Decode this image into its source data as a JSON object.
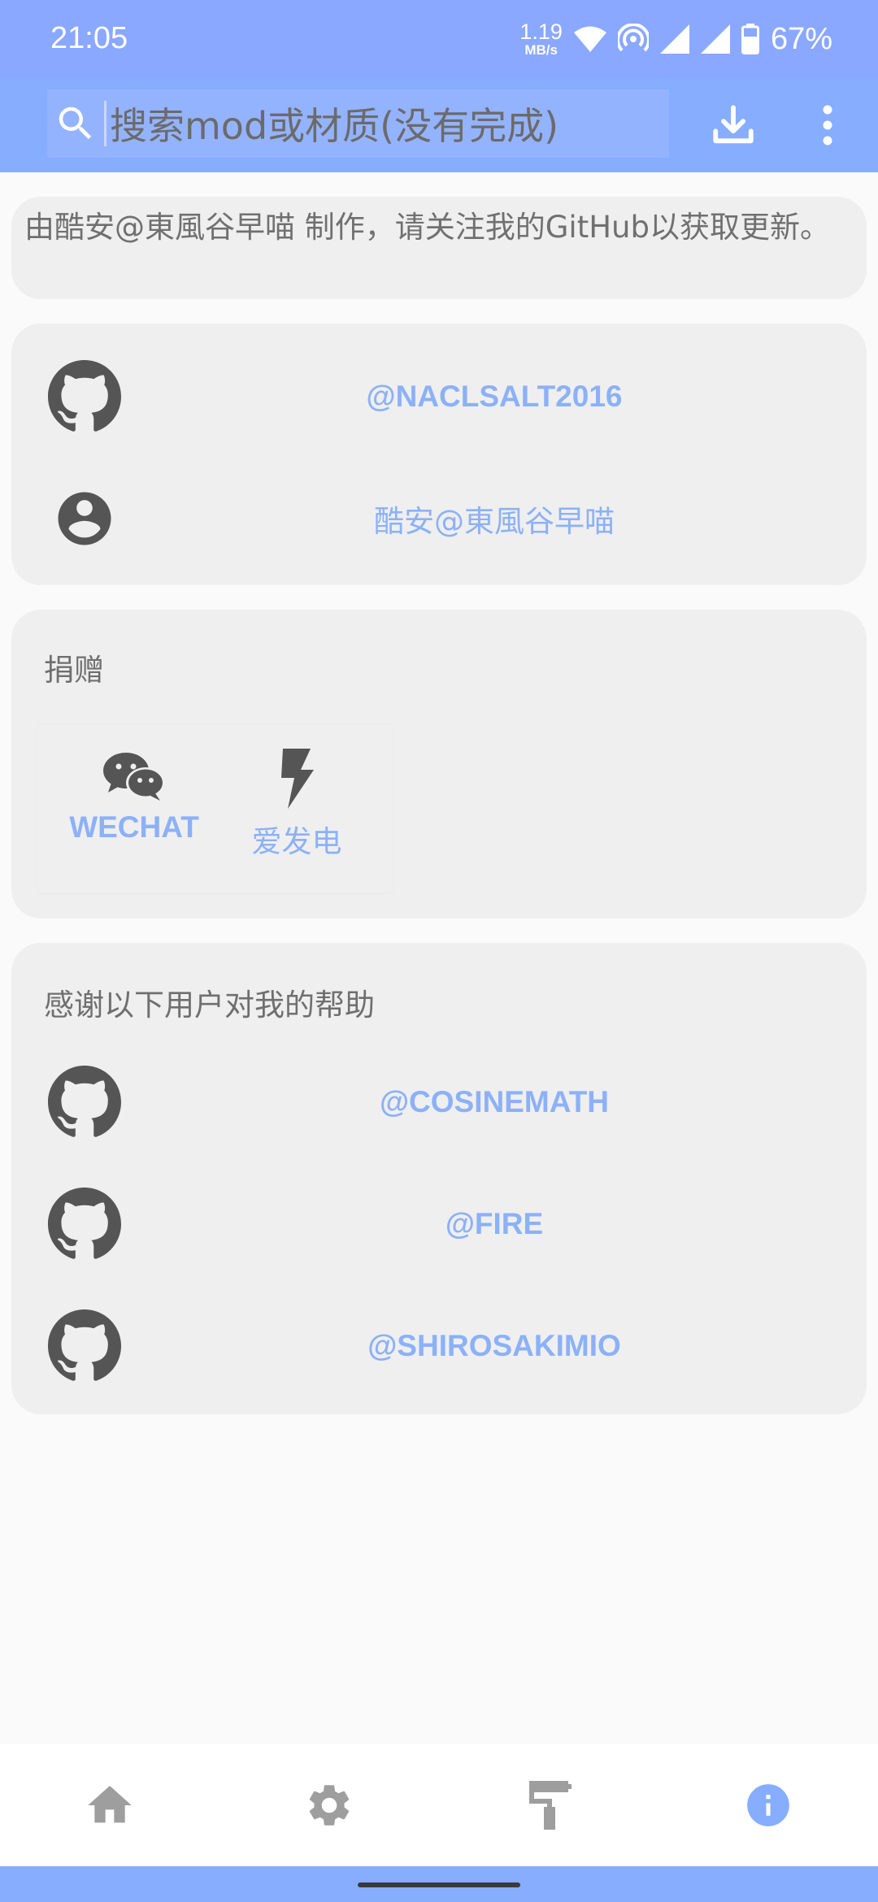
{
  "status_bar": {
    "time": "21:05",
    "net_speed_value": "1.19",
    "net_speed_unit": "MB/s",
    "battery": "67%",
    "icons": [
      "wifi-icon",
      "hotspot-icon",
      "signal-icon",
      "signal-icon",
      "battery-icon"
    ]
  },
  "app_bar": {
    "search_placeholder": "搜索mod或材质(没有完成)",
    "actions": [
      "download-icon",
      "more-vert-icon"
    ]
  },
  "notice": {
    "text": "由酷安@東風谷早喵 制作，请关注我的GitHub以获取更新。"
  },
  "author": {
    "github": "@NACLSALT2016",
    "coolapk": "酷安@東風谷早喵"
  },
  "donate": {
    "title": "捐赠",
    "wechat_label": "WECHAT",
    "afdian_label": "爱发电"
  },
  "thanks": {
    "title": "感谢以下用户对我的帮助",
    "users": [
      "@COSINEMATH",
      "@FIRE",
      "@SHIROSAKIMIO"
    ]
  },
  "bottom_nav": {
    "items": [
      "home-icon",
      "settings-icon",
      "paint-roller-icon",
      "info-icon"
    ],
    "active": "info-icon"
  },
  "colors": {
    "accent": "#86adff",
    "link": "#8cb1f7",
    "card": "#efefef",
    "icon_dark": "#555555",
    "nav_inactive": "#9e9e9e"
  }
}
